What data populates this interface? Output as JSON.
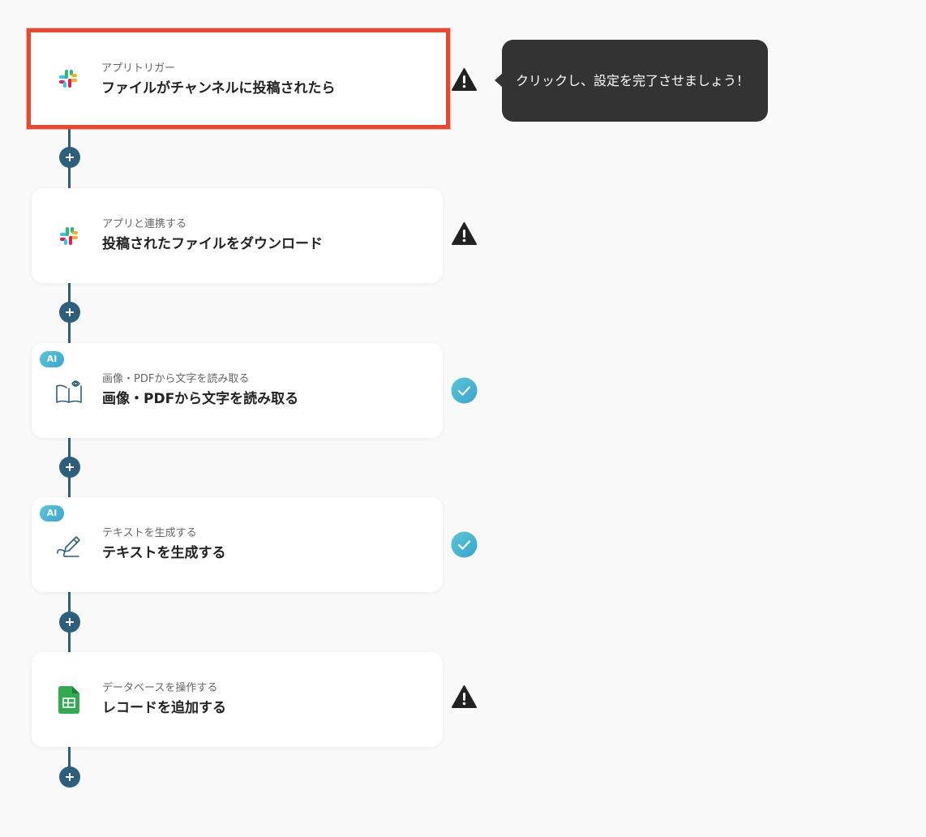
{
  "steps": [
    {
      "category": "アプリトリガー",
      "title": "ファイルがチャンネルに投稿されたら",
      "icon": "slack-icon",
      "status": "warning",
      "ai": false
    },
    {
      "category": "アプリと連携する",
      "title": "投稿されたファイルをダウンロード",
      "icon": "slack-icon",
      "status": "warning",
      "ai": false
    },
    {
      "category": "画像・PDFから文字を読み取る",
      "title": "画像・PDFから文字を読み取る",
      "icon": "book-eye-icon",
      "status": "done",
      "ai": true
    },
    {
      "category": "テキストを生成する",
      "title": "テキストを生成する",
      "icon": "pen-icon",
      "status": "done",
      "ai": true
    },
    {
      "category": "データベースを操作する",
      "title": "レコードを追加する",
      "icon": "google-sheets-icon",
      "status": "warning",
      "ai": false
    }
  ],
  "ai_badge": "AI",
  "tooltip": "クリックし、設定を完了させましょう！",
  "colors": {
    "flow_line": "#2d5f7c",
    "selected_border": "#e24a32",
    "warning": "#222222",
    "done_gradient_start": "#5cc6d6",
    "done_gradient_end": "#3ba3cf",
    "tooltip_bg": "#333333",
    "sheets_green": "#34a853"
  }
}
